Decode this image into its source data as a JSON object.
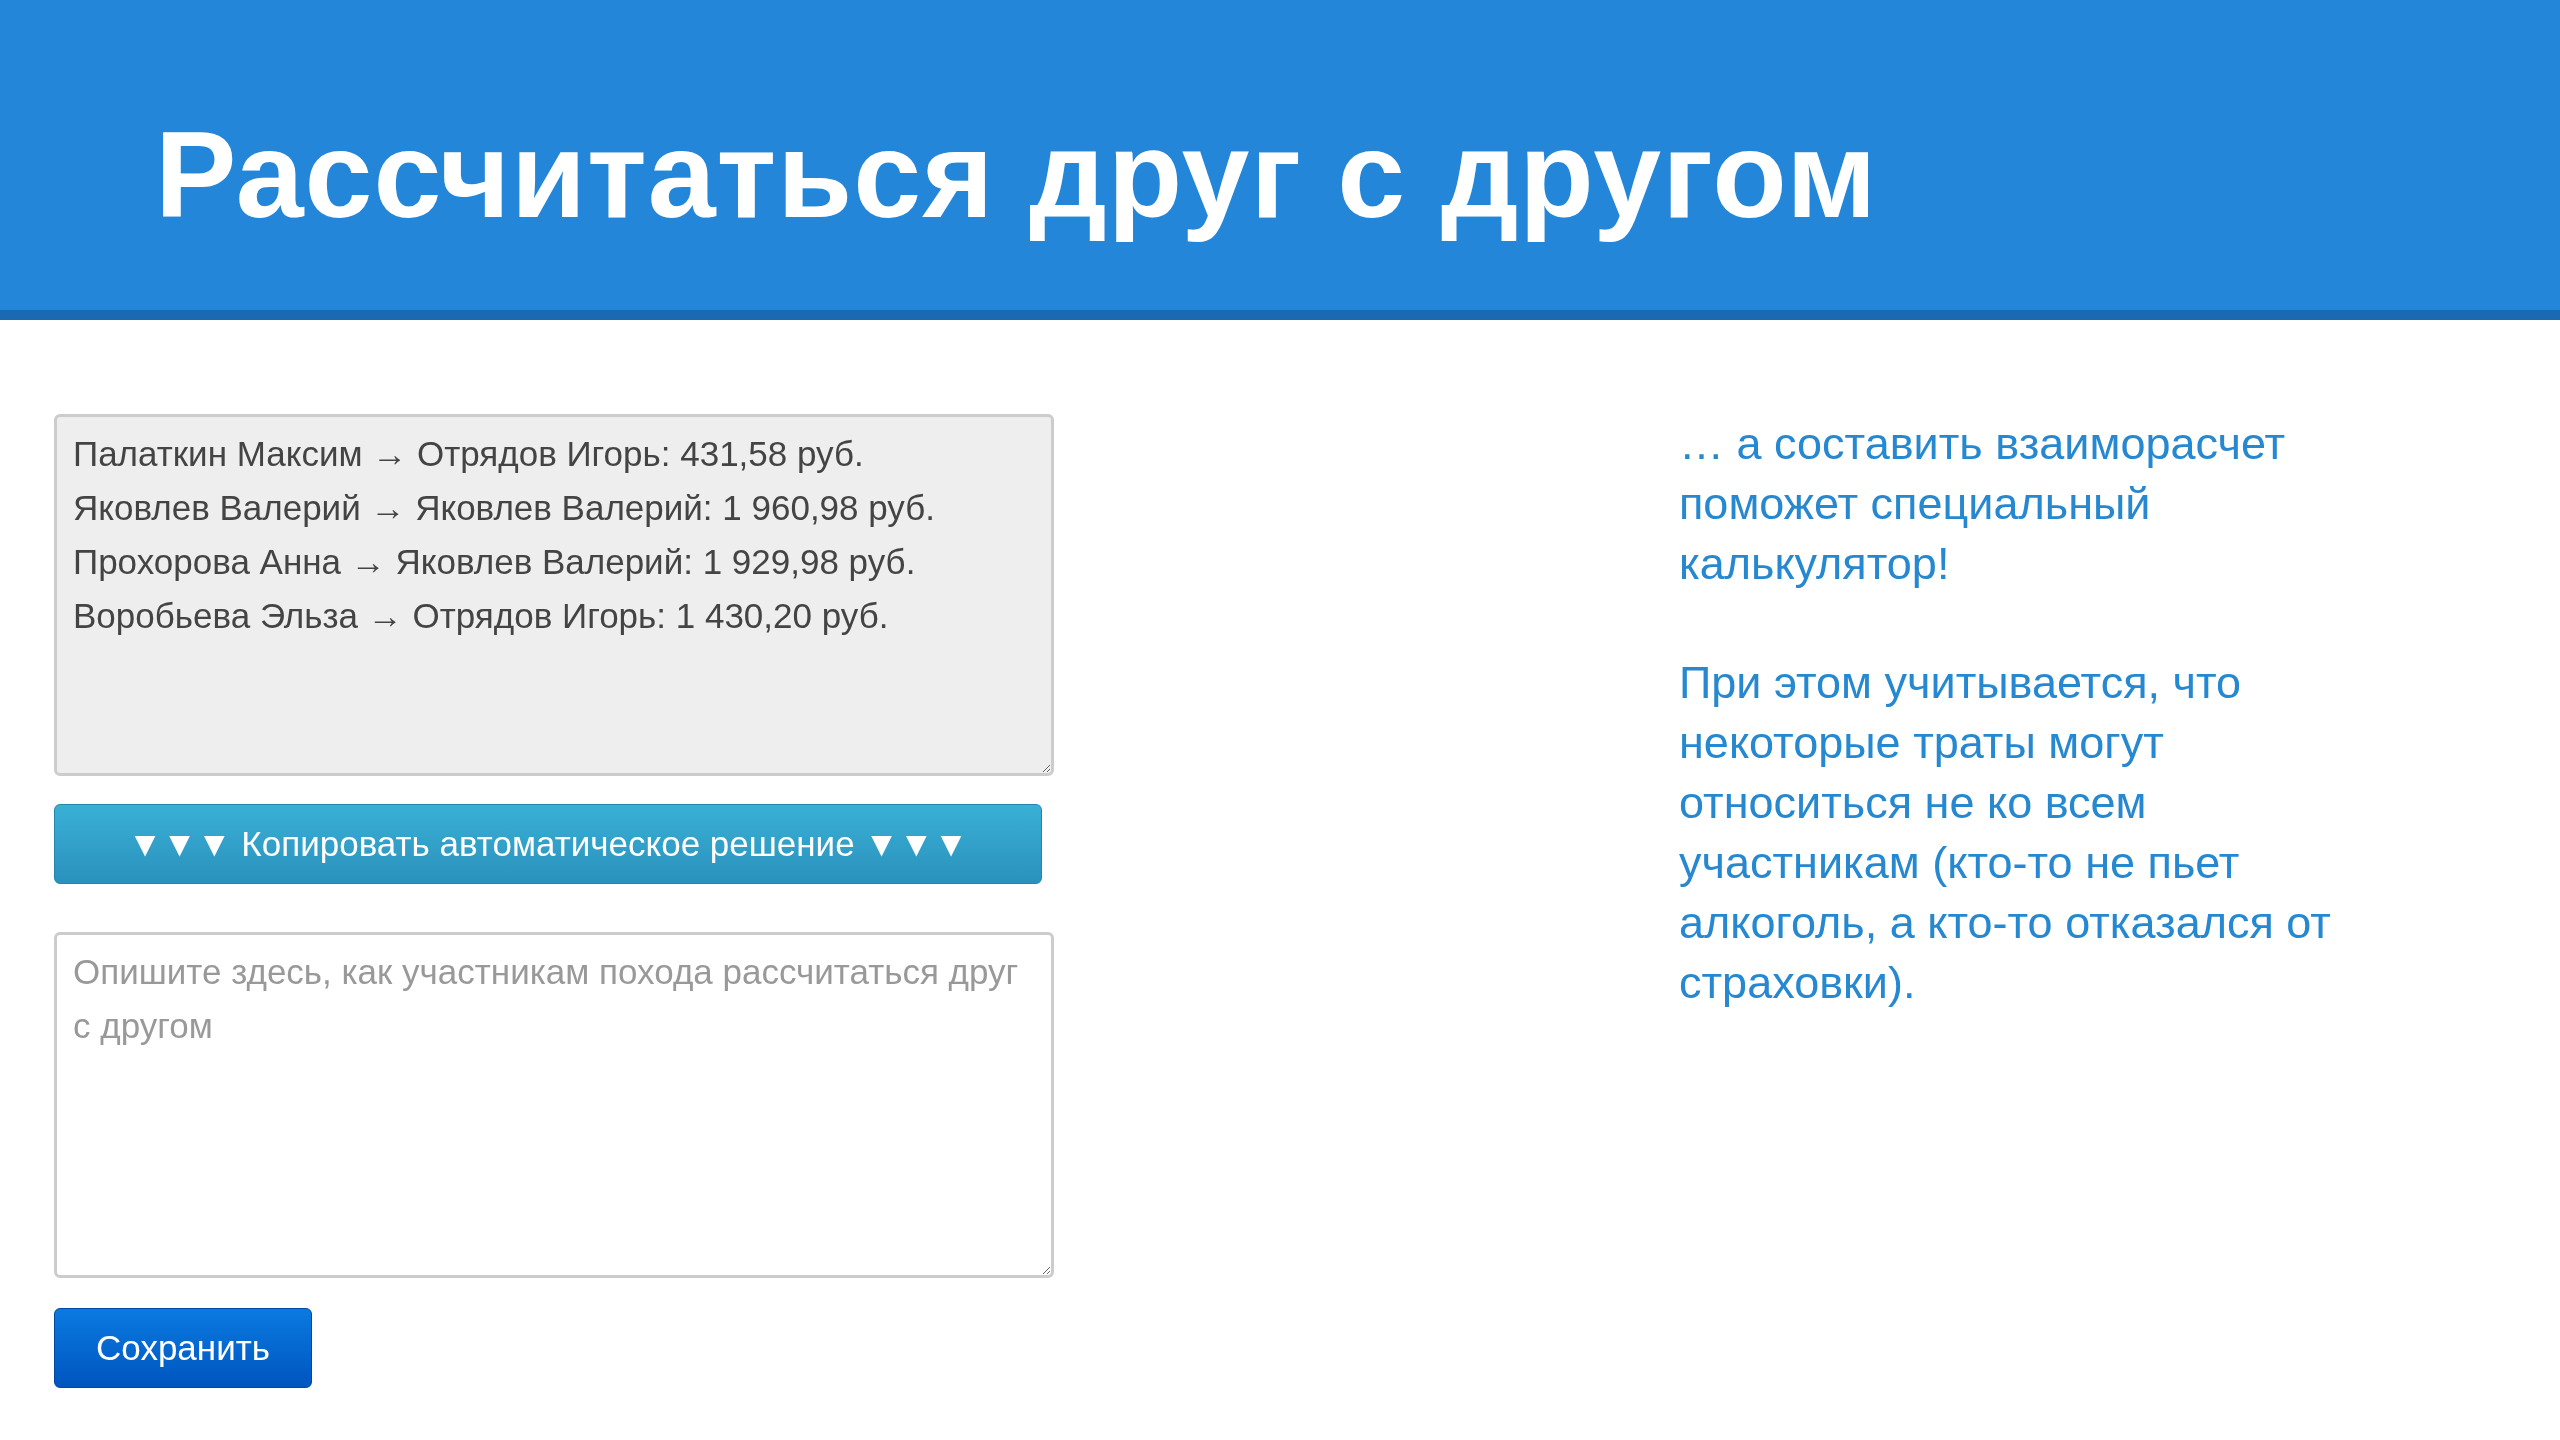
{
  "header": {
    "title": "Рассчитаться друг с другом"
  },
  "solution": {
    "readonly": true,
    "lines": [
      "Палаткин Максим → Отрядов Игорь: 431,58 руб.",
      "Яковлев Валерий → Яковлев Валерий: 1 960,98 руб.",
      "Прохорова Анна → Яковлев Валерий: 1 929,98 руб.",
      "Воробьева Эльза → Отрядов Игорь: 1 430,20 руб."
    ]
  },
  "copy_button": {
    "label": "▼▼▼ Копировать автоматическое решение ▼▼▼"
  },
  "description": {
    "placeholder": "Опишите здесь, как участникам похода рассчитаться друг с другом"
  },
  "save_button": {
    "label": "Сохранить"
  },
  "side_text": [
    "… а составить взаиморасчет поможет специальный калькулятор!",
    "При этом учитывается, что некоторые траты могут относиться не ко всем участникам (кто-то не пьет алкоголь, а кто-то отказался от страховки)."
  ]
}
